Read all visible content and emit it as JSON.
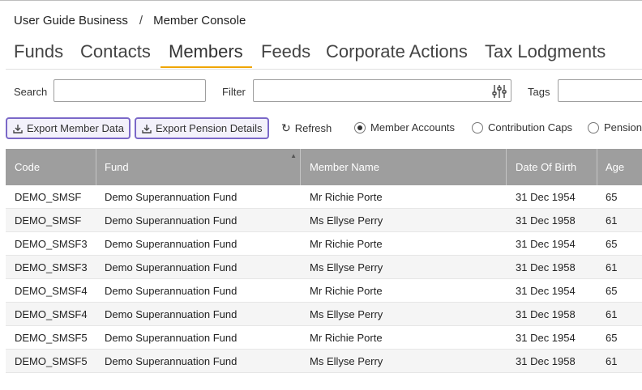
{
  "breadcrumb": {
    "root": "User Guide Business",
    "separator": "/",
    "current": "Member Console"
  },
  "tabs": [
    {
      "label": "Funds"
    },
    {
      "label": "Contacts"
    },
    {
      "label": "Members",
      "active": true
    },
    {
      "label": "Feeds"
    },
    {
      "label": "Corporate Actions"
    },
    {
      "label": "Tax Lodgments"
    }
  ],
  "filters": {
    "search_label": "Search",
    "search_value": "",
    "filter_label": "Filter",
    "filter_value": "",
    "tags_label": "Tags",
    "tags_value": ""
  },
  "toolbar": {
    "export_member_label": "Export Member Data",
    "export_pension_label": "Export Pension Details",
    "refresh_label": "Refresh",
    "accent_color": "#7b68c8",
    "views": [
      {
        "label": "Member Accounts",
        "selected": true
      },
      {
        "label": "Contribution Caps",
        "selected": false
      },
      {
        "label": "Pension",
        "selected": false
      }
    ]
  },
  "grid": {
    "header_color": "#9e9e9e",
    "columns": [
      "Code",
      "Fund",
      "Member Name",
      "Date Of Birth",
      "Age"
    ],
    "sorted_column": "Fund",
    "rows": [
      [
        "DEMO_SMSF",
        "Demo Superannuation Fund",
        "Mr Richie Porte",
        "31 Dec 1954",
        "65"
      ],
      [
        "DEMO_SMSF",
        "Demo Superannuation Fund",
        "Ms Ellyse Perry",
        "31 Dec 1958",
        "61"
      ],
      [
        "DEMO_SMSF3",
        "Demo Superannuation Fund",
        "Mr Richie Porte",
        "31 Dec 1954",
        "65"
      ],
      [
        "DEMO_SMSF3",
        "Demo Superannuation Fund",
        "Ms Ellyse Perry",
        "31 Dec 1958",
        "61"
      ],
      [
        "DEMO_SMSF4",
        "Demo Superannuation Fund",
        "Mr Richie Porte",
        "31 Dec 1954",
        "65"
      ],
      [
        "DEMO_SMSF4",
        "Demo Superannuation Fund",
        "Ms Ellyse Perry",
        "31 Dec 1958",
        "61"
      ],
      [
        "DEMO_SMSF5",
        "Demo Superannuation Fund",
        "Mr Richie Porte",
        "31 Dec 1954",
        "65"
      ],
      [
        "DEMO_SMSF5",
        "Demo Superannuation Fund",
        "Ms Ellyse Perry",
        "31 Dec 1958",
        "61"
      ]
    ]
  }
}
